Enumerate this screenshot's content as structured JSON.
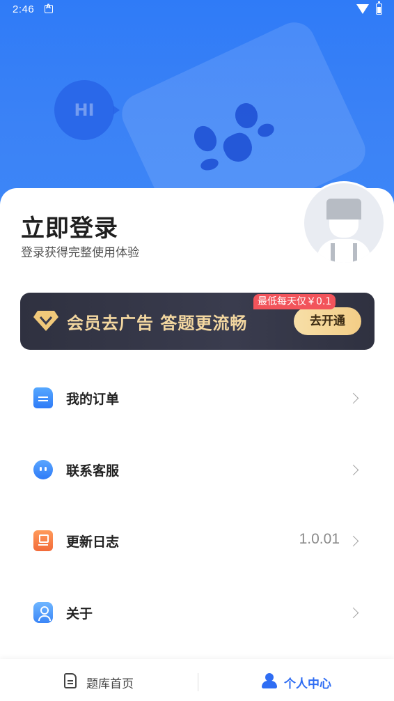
{
  "status_bar": {
    "time": "2:46"
  },
  "header": {
    "bubble_text": "HI"
  },
  "login": {
    "title": "立即登录",
    "subtitle": "登录获得完整使用体验"
  },
  "vip": {
    "text": "会员去广告 答题更流畅",
    "price_tag": "最低每天仅￥0.1",
    "button": "去开通"
  },
  "menu": [
    {
      "label": "我的订单",
      "icon": "order-icon",
      "value": ""
    },
    {
      "label": "联系客服",
      "icon": "customer-service-icon",
      "value": ""
    },
    {
      "label": "更新日志",
      "icon": "update-log-icon",
      "value": "1.0.01"
    },
    {
      "label": "关于",
      "icon": "about-icon",
      "value": ""
    }
  ],
  "bottom_nav": {
    "home_label": "题库首页",
    "me_label": "个人中心",
    "active": "个人中心"
  },
  "colors": {
    "header_blue": "#3b82f6",
    "accent_blue": "#2f6df3",
    "vip_gold": "#f3d7a0",
    "tag_red": "#f2545b"
  }
}
